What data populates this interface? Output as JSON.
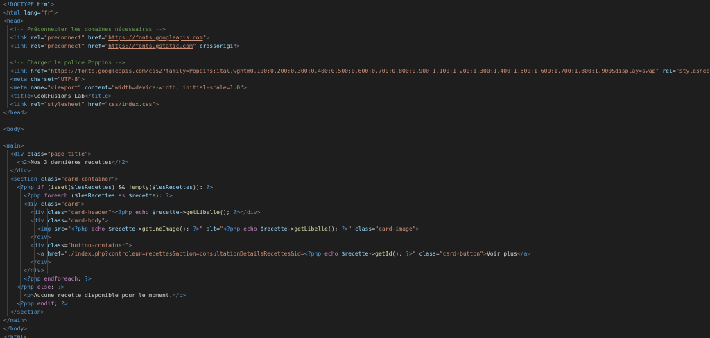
{
  "editor": {
    "colors": {
      "background": "#1e1e1e",
      "tag": "#569cd6",
      "attribute": "#9cdcfe",
      "string": "#ce9178",
      "comment": "#6a9955",
      "keyword": "#c586c0",
      "function": "#dcdcaa",
      "text": "#d4d4d4"
    },
    "lines": [
      [
        [
          "punct",
          "<!"
        ],
        [
          "tag",
          "DOCTYPE"
        ],
        [
          "text",
          " "
        ],
        [
          "attr",
          "html"
        ],
        [
          "punct",
          ">"
        ]
      ],
      [
        [
          "punct",
          "<"
        ],
        [
          "tag",
          "html"
        ],
        [
          "text",
          " "
        ],
        [
          "attr",
          "lang"
        ],
        [
          "text",
          "="
        ],
        [
          "str",
          "\"fr\""
        ],
        [
          "punct",
          ">"
        ]
      ],
      [
        [
          "punct",
          "<"
        ],
        [
          "tag",
          "head"
        ],
        [
          "punct",
          ">"
        ]
      ],
      [
        [
          "text",
          "  "
        ],
        [
          "comment",
          "<!-- Préconnecter les domaines nécessaires -->"
        ]
      ],
      [
        [
          "text",
          "  "
        ],
        [
          "punct",
          "<"
        ],
        [
          "tag",
          "link"
        ],
        [
          "text",
          " "
        ],
        [
          "attr",
          "rel"
        ],
        [
          "text",
          "="
        ],
        [
          "str",
          "\"preconnect\""
        ],
        [
          "text",
          " "
        ],
        [
          "attr",
          "href"
        ],
        [
          "text",
          "="
        ],
        [
          "str",
          "\""
        ],
        [
          "link",
          "https://fonts.googleapis.com"
        ],
        [
          "str",
          "\""
        ],
        [
          "punct",
          ">"
        ]
      ],
      [
        [
          "text",
          "  "
        ],
        [
          "punct",
          "<"
        ],
        [
          "tag",
          "link"
        ],
        [
          "text",
          " "
        ],
        [
          "attr",
          "rel"
        ],
        [
          "text",
          "="
        ],
        [
          "str",
          "\"preconnect\""
        ],
        [
          "text",
          " "
        ],
        [
          "attr",
          "href"
        ],
        [
          "text",
          "="
        ],
        [
          "str",
          "\""
        ],
        [
          "link",
          "https://fonts.gstatic.com"
        ],
        [
          "str",
          "\""
        ],
        [
          "text",
          " "
        ],
        [
          "attr",
          "crossorigin"
        ],
        [
          "punct",
          ">"
        ]
      ],
      [],
      [
        [
          "text",
          "  "
        ],
        [
          "comment",
          "<!-- Charger la police Poppins -->"
        ]
      ],
      [
        [
          "text",
          "  "
        ],
        [
          "punct",
          "<"
        ],
        [
          "tag",
          "link"
        ],
        [
          "text",
          " "
        ],
        [
          "attr",
          "href"
        ],
        [
          "text",
          "="
        ],
        [
          "str",
          "\"https://fonts.googleapis.com/css2?family=Poppins:ital,wght@0,100;0,200;0,300;0,400;0,500;0,600;0,700;0,800;0,900;1,100;1,200;1,300;1,400;1,500;1,600;1,700;1,800;1,900&display=swap\""
        ],
        [
          "text",
          " "
        ],
        [
          "attr",
          "rel"
        ],
        [
          "text",
          "="
        ],
        [
          "str",
          "\"stylesheet\""
        ],
        [
          "punct",
          ">"
        ]
      ],
      [
        [
          "text",
          "  "
        ],
        [
          "punct",
          "<"
        ],
        [
          "tag",
          "meta"
        ],
        [
          "text",
          " "
        ],
        [
          "attr",
          "charset"
        ],
        [
          "text",
          "="
        ],
        [
          "str",
          "\"UTF-8\""
        ],
        [
          "punct",
          ">"
        ]
      ],
      [
        [
          "text",
          "  "
        ],
        [
          "punct",
          "<"
        ],
        [
          "tag",
          "meta"
        ],
        [
          "text",
          " "
        ],
        [
          "attr",
          "name"
        ],
        [
          "text",
          "="
        ],
        [
          "str",
          "\"viewport\""
        ],
        [
          "text",
          " "
        ],
        [
          "attr",
          "content"
        ],
        [
          "text",
          "="
        ],
        [
          "str",
          "\"width=device-width, initial-scale=1.0\""
        ],
        [
          "punct",
          ">"
        ]
      ],
      [
        [
          "text",
          "  "
        ],
        [
          "punct",
          "<"
        ],
        [
          "tag",
          "title"
        ],
        [
          "punct",
          ">"
        ],
        [
          "text",
          "CookFusions Lab"
        ],
        [
          "punct",
          "</"
        ],
        [
          "tag",
          "title"
        ],
        [
          "punct",
          ">"
        ]
      ],
      [
        [
          "text",
          "  "
        ],
        [
          "punct",
          "<"
        ],
        [
          "tag",
          "link"
        ],
        [
          "text",
          " "
        ],
        [
          "attr",
          "rel"
        ],
        [
          "text",
          "="
        ],
        [
          "str",
          "\"stylesheet\""
        ],
        [
          "text",
          " "
        ],
        [
          "attr",
          "href"
        ],
        [
          "text",
          "="
        ],
        [
          "str",
          "\"css/index.css\""
        ],
        [
          "punct",
          ">"
        ]
      ],
      [
        [
          "punct",
          "</"
        ],
        [
          "tag",
          "head"
        ],
        [
          "punct",
          ">"
        ]
      ],
      [],
      [
        [
          "punct",
          "<"
        ],
        [
          "tag",
          "body"
        ],
        [
          "punct",
          ">"
        ]
      ],
      [],
      [
        [
          "punct",
          "<"
        ],
        [
          "tag",
          "main"
        ],
        [
          "punct",
          ">"
        ]
      ],
      [
        [
          "text",
          "  "
        ],
        [
          "punct",
          "<"
        ],
        [
          "tag",
          "div"
        ],
        [
          "text",
          " "
        ],
        [
          "attr",
          "class"
        ],
        [
          "text",
          "="
        ],
        [
          "str",
          "\"page_title\""
        ],
        [
          "punct",
          ">"
        ]
      ],
      [
        [
          "text",
          "    "
        ],
        [
          "punct",
          "<"
        ],
        [
          "tag",
          "h2"
        ],
        [
          "punct",
          ">"
        ],
        [
          "text",
          "Nos 3 dernières recettes"
        ],
        [
          "punct",
          "</"
        ],
        [
          "tag",
          "h2"
        ],
        [
          "punct",
          ">"
        ]
      ],
      [
        [
          "text",
          "  "
        ],
        [
          "punct",
          "</"
        ],
        [
          "tag",
          "div"
        ],
        [
          "punct",
          ">"
        ]
      ],
      [
        [
          "text",
          "  "
        ],
        [
          "punct",
          "<"
        ],
        [
          "tag",
          "section"
        ],
        [
          "text",
          " "
        ],
        [
          "attr",
          "class"
        ],
        [
          "text",
          "="
        ],
        [
          "str",
          "\"card-container\""
        ],
        [
          "punct",
          ">"
        ]
      ],
      [
        [
          "text",
          "    "
        ],
        [
          "php",
          "<?php"
        ],
        [
          "text",
          " "
        ],
        [
          "kw",
          "if"
        ],
        [
          "text",
          " ("
        ],
        [
          "fn",
          "isset"
        ],
        [
          "text",
          "("
        ],
        [
          "var",
          "$lesRecettes"
        ],
        [
          "text",
          ") && !"
        ],
        [
          "fn",
          "empty"
        ],
        [
          "text",
          "("
        ],
        [
          "var",
          "$lesRecettes"
        ],
        [
          "text",
          ")): "
        ],
        [
          "php",
          "?>"
        ]
      ],
      [
        [
          "text",
          "      "
        ],
        [
          "php",
          "<?php"
        ],
        [
          "text",
          " "
        ],
        [
          "kw",
          "foreach"
        ],
        [
          "text",
          " ("
        ],
        [
          "var",
          "$lesRecettes"
        ],
        [
          "text",
          " "
        ],
        [
          "kw",
          "as"
        ],
        [
          "text",
          " "
        ],
        [
          "var",
          "$recette"
        ],
        [
          "text",
          "): "
        ],
        [
          "php",
          "?>"
        ]
      ],
      [
        [
          "text",
          "      "
        ],
        [
          "punct",
          "<"
        ],
        [
          "tag",
          "div"
        ],
        [
          "text",
          " "
        ],
        [
          "attr",
          "class"
        ],
        [
          "text",
          "="
        ],
        [
          "str",
          "\"card\""
        ],
        [
          "punct",
          ">"
        ]
      ],
      [
        [
          "text",
          "        "
        ],
        [
          "punct",
          "<"
        ],
        [
          "tag",
          "div"
        ],
        [
          "text",
          " "
        ],
        [
          "attr",
          "class"
        ],
        [
          "text",
          "="
        ],
        [
          "str",
          "\"card-header\""
        ],
        [
          "punct",
          ">"
        ],
        [
          "php",
          "<?php"
        ],
        [
          "text",
          " "
        ],
        [
          "kw",
          "echo"
        ],
        [
          "text",
          " "
        ],
        [
          "var",
          "$recette"
        ],
        [
          "text",
          "->"
        ],
        [
          "fn",
          "getLibelle"
        ],
        [
          "text",
          "(); "
        ],
        [
          "php",
          "?>"
        ],
        [
          "punct",
          "</"
        ],
        [
          "tag",
          "div"
        ],
        [
          "punct",
          ">"
        ]
      ],
      [
        [
          "text",
          "        "
        ],
        [
          "punct",
          "<"
        ],
        [
          "tag",
          "div"
        ],
        [
          "text",
          " "
        ],
        [
          "attr",
          "class"
        ],
        [
          "text",
          "="
        ],
        [
          "str",
          "\"card-body\""
        ],
        [
          "punct",
          ">"
        ]
      ],
      [
        [
          "text",
          "          "
        ],
        [
          "punct",
          "<"
        ],
        [
          "tag",
          "img"
        ],
        [
          "text",
          " "
        ],
        [
          "attr",
          "src"
        ],
        [
          "text",
          "="
        ],
        [
          "str",
          "\""
        ],
        [
          "php",
          "<?php"
        ],
        [
          "text",
          " "
        ],
        [
          "kw",
          "echo"
        ],
        [
          "text",
          " "
        ],
        [
          "var",
          "$recette"
        ],
        [
          "text",
          "->"
        ],
        [
          "fn",
          "getUneImage"
        ],
        [
          "text",
          "(); "
        ],
        [
          "php",
          "?>"
        ],
        [
          "str",
          "\""
        ],
        [
          "text",
          " "
        ],
        [
          "attr",
          "alt"
        ],
        [
          "text",
          "="
        ],
        [
          "str",
          "\""
        ],
        [
          "php",
          "<?php"
        ],
        [
          "text",
          " "
        ],
        [
          "kw",
          "echo"
        ],
        [
          "text",
          " "
        ],
        [
          "var",
          "$recette"
        ],
        [
          "text",
          "->"
        ],
        [
          "fn",
          "getLibelle"
        ],
        [
          "text",
          "(); "
        ],
        [
          "php",
          "?>"
        ],
        [
          "str",
          "\""
        ],
        [
          "text",
          " "
        ],
        [
          "attr",
          "class"
        ],
        [
          "text",
          "="
        ],
        [
          "str",
          "\"card-image\""
        ],
        [
          "punct",
          ">"
        ]
      ],
      [
        [
          "text",
          "        "
        ],
        [
          "punct",
          "</"
        ],
        [
          "tag",
          "div"
        ],
        [
          "punct",
          ">"
        ]
      ],
      [
        [
          "text",
          "        "
        ],
        [
          "punct",
          "<"
        ],
        [
          "tag",
          "div"
        ],
        [
          "text",
          " "
        ],
        [
          "attr",
          "class"
        ],
        [
          "text",
          "="
        ],
        [
          "str",
          "\"button-container\""
        ],
        [
          "punct",
          ">"
        ]
      ],
      [
        [
          "text",
          "          "
        ],
        [
          "punct",
          "<"
        ],
        [
          "tag",
          "a"
        ],
        [
          "text",
          " "
        ],
        [
          "attr",
          "href"
        ],
        [
          "text",
          "="
        ],
        [
          "str",
          "\"./index.php?controleur=recettes&action=consultationDetailsRecettes&id="
        ],
        [
          "php",
          "<?php"
        ],
        [
          "text",
          " "
        ],
        [
          "kw",
          "echo"
        ],
        [
          "text",
          " "
        ],
        [
          "var",
          "$recette"
        ],
        [
          "text",
          "->"
        ],
        [
          "fn",
          "getId"
        ],
        [
          "text",
          "(); "
        ],
        [
          "php",
          "?>"
        ],
        [
          "str",
          "\""
        ],
        [
          "text",
          " "
        ],
        [
          "attr",
          "class"
        ],
        [
          "text",
          "="
        ],
        [
          "str",
          "\"card-button\""
        ],
        [
          "punct",
          ">"
        ],
        [
          "text",
          "Voir plus"
        ],
        [
          "punct",
          "</"
        ],
        [
          "tag",
          "a"
        ],
        [
          "punct",
          ">"
        ]
      ],
      [
        [
          "text",
          "        "
        ],
        [
          "punct",
          "</"
        ],
        [
          "tag",
          "div"
        ],
        [
          "punct",
          ">"
        ]
      ],
      [
        [
          "text",
          "      "
        ],
        [
          "punct",
          "</"
        ],
        [
          "tag",
          "div"
        ],
        [
          "punct",
          ">"
        ]
      ],
      [
        [
          "text",
          "      "
        ],
        [
          "php",
          "<?php"
        ],
        [
          "text",
          " "
        ],
        [
          "kw",
          "endforeach"
        ],
        [
          "text",
          "; "
        ],
        [
          "php",
          "?>"
        ]
      ],
      [
        [
          "text",
          "    "
        ],
        [
          "php",
          "<?php"
        ],
        [
          "text",
          " "
        ],
        [
          "kw",
          "else"
        ],
        [
          "text",
          ": "
        ],
        [
          "php",
          "?>"
        ]
      ],
      [
        [
          "text",
          "      "
        ],
        [
          "punct",
          "<"
        ],
        [
          "tag",
          "p"
        ],
        [
          "punct",
          ">"
        ],
        [
          "text",
          "Aucune recette disponible pour le moment."
        ],
        [
          "punct",
          "</"
        ],
        [
          "tag",
          "p"
        ],
        [
          "punct",
          ">"
        ]
      ],
      [
        [
          "text",
          "    "
        ],
        [
          "php",
          "<?php"
        ],
        [
          "text",
          " "
        ],
        [
          "kw",
          "endif"
        ],
        [
          "text",
          "; "
        ],
        [
          "php",
          "?>"
        ]
      ],
      [
        [
          "text",
          "  "
        ],
        [
          "punct",
          "</"
        ],
        [
          "tag",
          "section"
        ],
        [
          "punct",
          ">"
        ]
      ],
      [
        [
          "punct",
          "</"
        ],
        [
          "tag",
          "main"
        ],
        [
          "punct",
          ">"
        ]
      ],
      [
        [
          "punct",
          "</"
        ],
        [
          "tag",
          "body"
        ],
        [
          "punct",
          ">"
        ]
      ],
      [
        [
          "punct",
          "</"
        ],
        [
          "tag",
          "html"
        ],
        [
          "punct",
          ">"
        ]
      ]
    ]
  }
}
